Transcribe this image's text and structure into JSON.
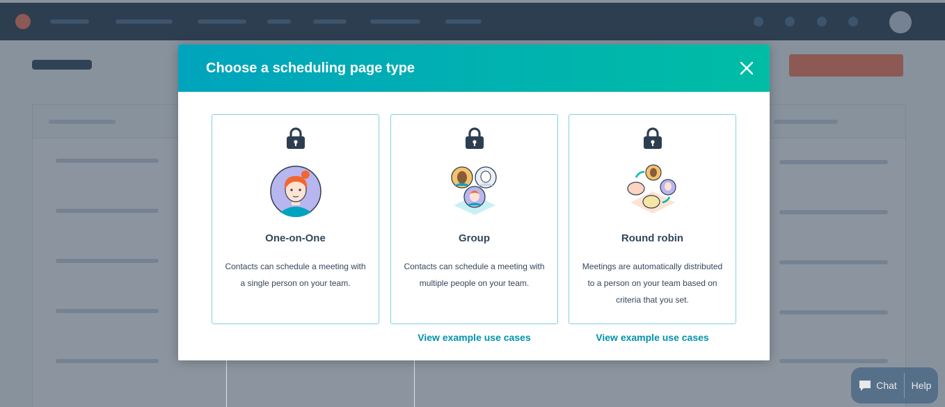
{
  "modal": {
    "title": "Choose a scheduling page type"
  },
  "options": [
    {
      "name": "One-on-One",
      "description": "Contacts can schedule a meeting with a single person on your team."
    },
    {
      "name": "Group",
      "description": "Contacts can schedule a meeting with multiple people on your team.",
      "link": "View example use cases"
    },
    {
      "name": "Round robin",
      "description": "Meetings are automatically distributed to a person on your team based on criteria that you set.",
      "link": "View example use cases"
    }
  ],
  "chat_widget": {
    "chat_label": "Chat",
    "help_label": "Help"
  },
  "colors": {
    "header_gradient_start": "#00a4bd",
    "header_gradient_end": "#00bda5",
    "card_border": "#7fd1de",
    "link": "#0091ae",
    "text": "#33475b",
    "nav": "#2d3e50"
  },
  "icons": {
    "lock": "lock-icon",
    "close": "close-icon",
    "chat": "chat-bubble-icon"
  }
}
